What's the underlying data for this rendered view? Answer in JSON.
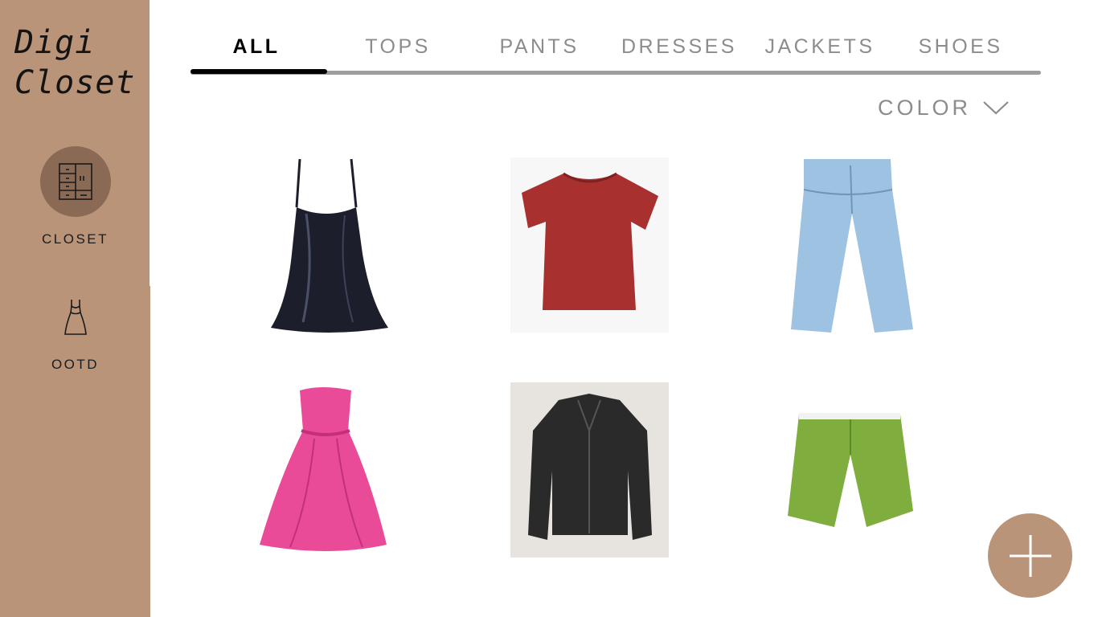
{
  "app": {
    "title_line1": "Digi",
    "title_line2": "Closet"
  },
  "sidebar": {
    "items": [
      {
        "label": "CLOSET",
        "icon": "wardrobe-icon",
        "active": true
      },
      {
        "label": "OOTD",
        "icon": "dress-icon",
        "active": false
      }
    ],
    "accent": "#b99479",
    "active_circle": "#8a6a55"
  },
  "tabs": [
    {
      "label": "ALL",
      "active": true
    },
    {
      "label": "TOPS",
      "active": false
    },
    {
      "label": "PANTS",
      "active": false
    },
    {
      "label": "DRESSES",
      "active": false
    },
    {
      "label": "JACKETS",
      "active": false
    },
    {
      "label": "SHOES",
      "active": false
    }
  ],
  "filter": {
    "label": "COLOR",
    "icon": "chevron-down-icon"
  },
  "items": [
    {
      "name": "black satin camisole",
      "color": "#1c1f2b"
    },
    {
      "name": "red t-shirt",
      "color": "#a8302f"
    },
    {
      "name": "light wash jeans",
      "color": "#9ec3e2"
    },
    {
      "name": "pink strapless dress",
      "color": "#ea4b99"
    },
    {
      "name": "black leather jacket",
      "color": "#2a2a2a"
    },
    {
      "name": "green shorts",
      "color": "#7fae3e"
    }
  ],
  "add_button": {
    "icon": "plus-icon",
    "color": "#b99479"
  }
}
